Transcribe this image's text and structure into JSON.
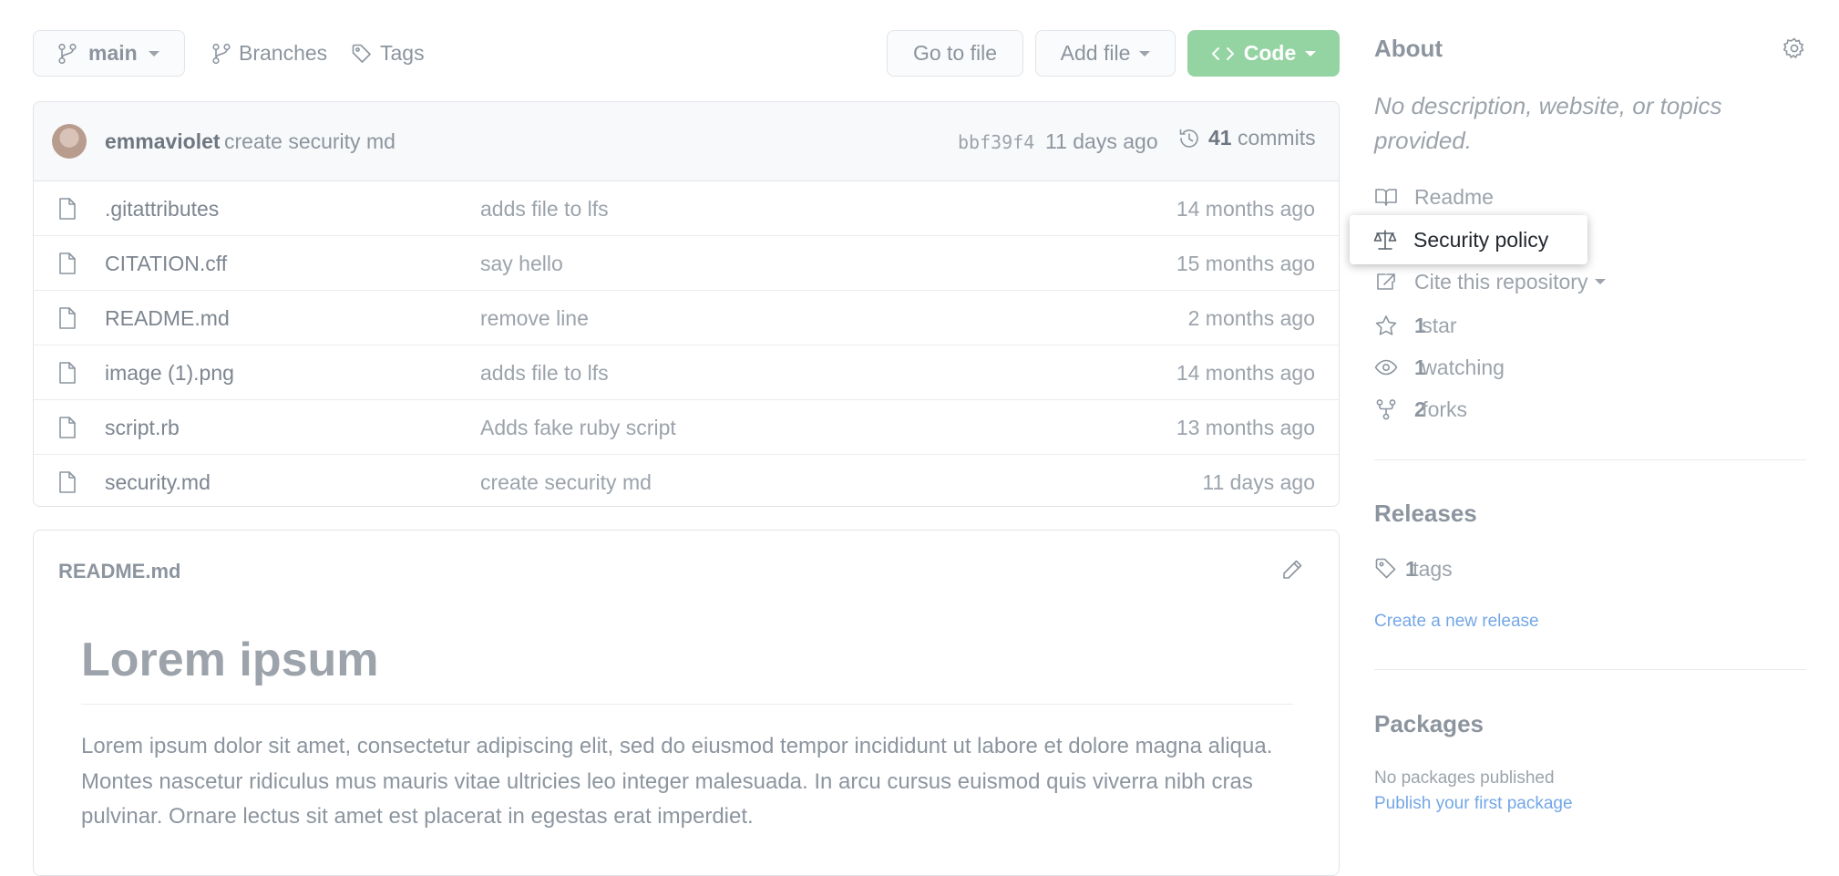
{
  "toolbar": {
    "branch": "main",
    "branches_label": "Branches",
    "tags_label": "Tags",
    "go_to_file": "Go to file",
    "add_file": "Add file",
    "code": "Code"
  },
  "latest_commit": {
    "author": "emmaviolet",
    "message": "create security md",
    "sha": "bbf39f4",
    "time": "11 days ago",
    "commit_count": "41",
    "commits_label": "commits"
  },
  "files": [
    {
      "name": ".gitattributes",
      "message": "adds file to lfs",
      "time": "14 months ago"
    },
    {
      "name": "CITATION.cff",
      "message": "say hello",
      "time": "15 months ago"
    },
    {
      "name": "README.md",
      "message": "remove line",
      "time": "2 months ago"
    },
    {
      "name": "image (1).png",
      "message": "adds file to lfs",
      "time": "14 months ago"
    },
    {
      "name": "script.rb",
      "message": "Adds fake ruby script",
      "time": "13 months ago"
    },
    {
      "name": "security.md",
      "message": "create security md",
      "time": "11 days ago"
    }
  ],
  "readme": {
    "filename": "README.md",
    "heading": "Lorem ipsum",
    "body": "Lorem ipsum dolor sit amet, consectetur adipiscing elit, sed do eiusmod tempor incididunt ut labore et dolore magna aliqua. Montes nascetur ridiculus mus mauris vitae ultricies leo integer malesuada. In arcu cursus euismod quis viverra nibh cras pulvinar. Ornare lectus sit amet est placerat in egestas erat imperdiet."
  },
  "about": {
    "title": "About",
    "description": "No description, website, or topics provided.",
    "readme": "Readme",
    "security_policy": "Security policy",
    "cite": "Cite this repository",
    "stars_count": "1",
    "stars_label": "star",
    "watching_count": "1",
    "watching_label": "watching",
    "forks_count": "2",
    "forks_label": "forks"
  },
  "releases": {
    "title": "Releases",
    "tags_count": "1",
    "tags_label": "tags",
    "create_link": "Create a new release"
  },
  "packages": {
    "title": "Packages",
    "none": "No packages published",
    "publish_link": "Publish your first package"
  },
  "colors": {
    "code_button": "#94d3a2",
    "link": "#74a7e6",
    "muted_text": "#8c959f"
  }
}
